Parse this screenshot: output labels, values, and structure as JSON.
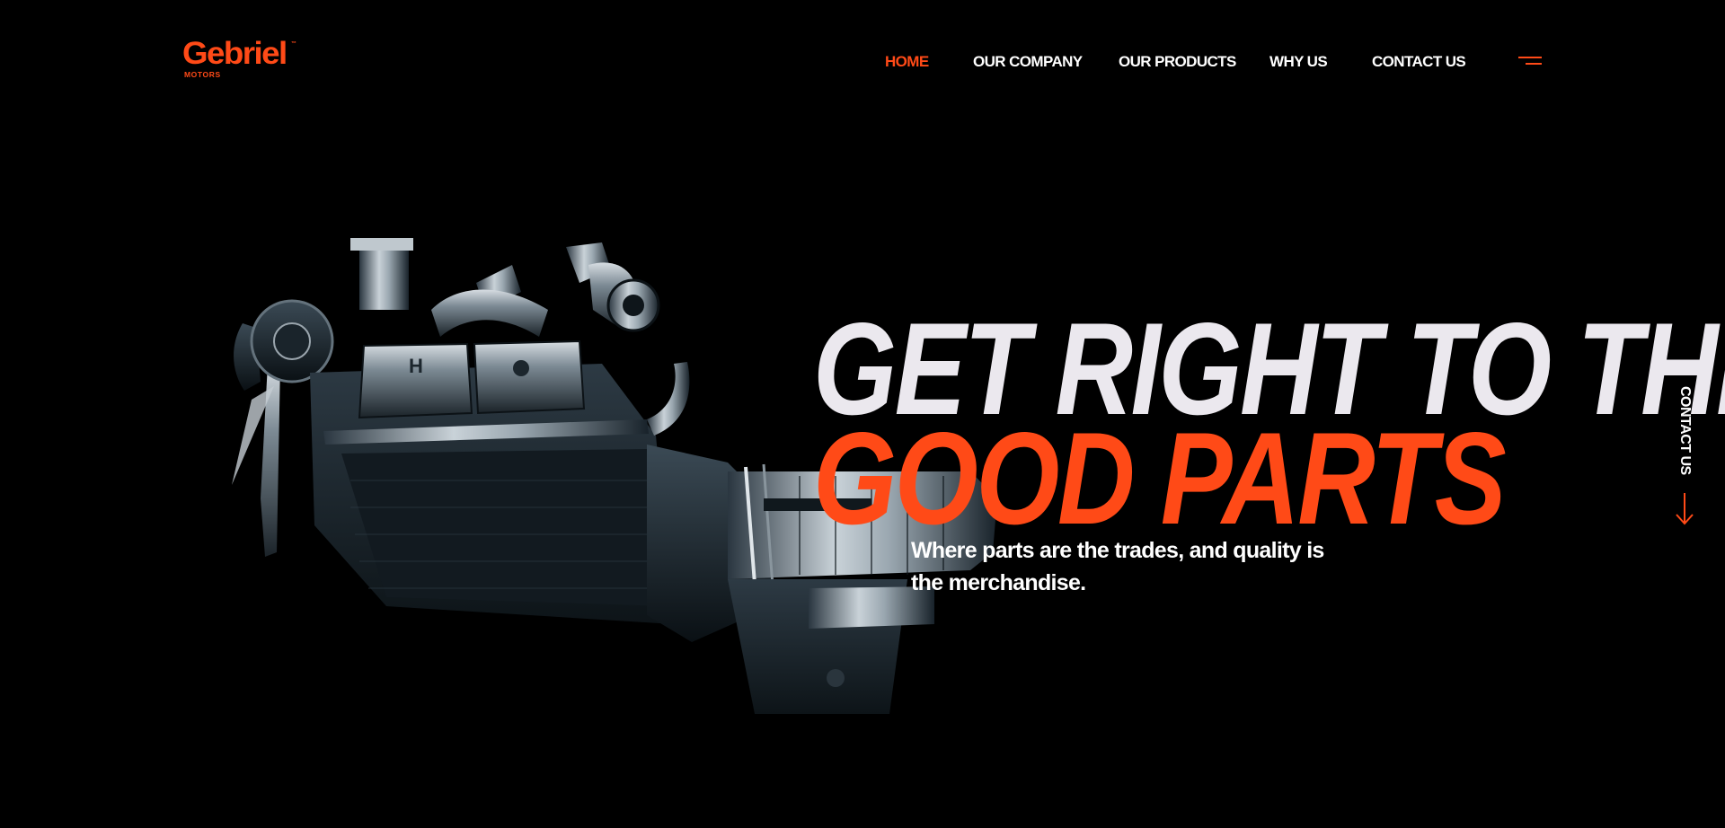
{
  "brand": {
    "name": "Gebriel",
    "tm": "™",
    "sub": "MOTORS",
    "accent_color": "#ff4a17"
  },
  "nav": {
    "items": [
      {
        "label": "HOME",
        "active": true
      },
      {
        "label": "OUR COMPANY",
        "active": false
      },
      {
        "label": "OUR PRODUCTS",
        "active": false
      },
      {
        "label": "WHY US",
        "active": false
      },
      {
        "label": "CONTACT US",
        "active": false
      }
    ],
    "menu_icon": "hamburger-menu-icon"
  },
  "hero": {
    "line1": "GET RIGHT TO THE",
    "line2": "GOOD PARTS",
    "subtitle": "Where parts are the trades, and quality is the merchandise.",
    "image": "engine-image"
  },
  "side": {
    "contact_label": "CONTACT US",
    "arrow_icon": "arrow-down-icon"
  }
}
